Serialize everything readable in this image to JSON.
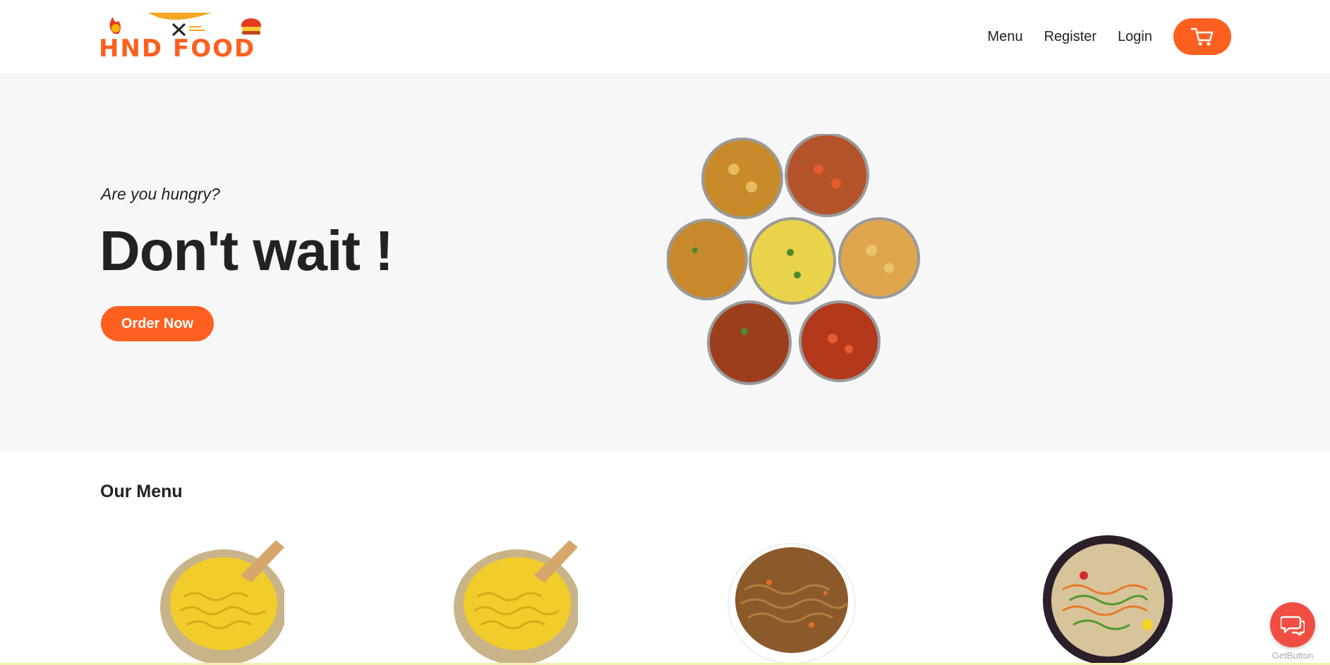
{
  "header": {
    "logo_text": "HND FOOD",
    "nav": {
      "menu": "Menu",
      "register": "Register",
      "login": "Login"
    },
    "cart_icon": "shopping-cart-icon"
  },
  "hero": {
    "tagline": "Are you hungry?",
    "title": "Don't wait !",
    "cta": "Order Now"
  },
  "menu": {
    "title": "Our Menu"
  },
  "chat": {
    "icon": "chat-bubbles-icon",
    "caption": "GetButton"
  },
  "colors": {
    "accent": "#ff5f1f",
    "hero_bg": "#f7f7f7",
    "chat": "#f04e42"
  }
}
